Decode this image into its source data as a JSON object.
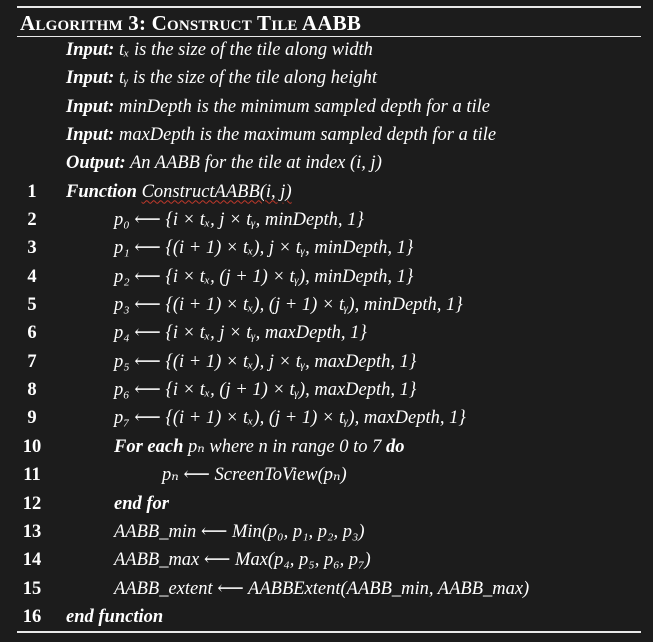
{
  "title": "Algorithm 3: Construct Tile AABB",
  "header_lines": [
    {
      "keyword": "Input:",
      "text": "tₓ is the size of the tile along width"
    },
    {
      "keyword": "Input:",
      "text": "tᵧ is the size of the tile along height"
    },
    {
      "keyword": "Input:",
      "text": "minDepth is the minimum sampled depth for a tile"
    },
    {
      "keyword": "Input:",
      "text": "maxDepth is the maximum sampled depth for a tile"
    },
    {
      "keyword": "Output:",
      "text": "An AABB for the tile at index (i, j)"
    }
  ],
  "steps": [
    {
      "num": "1",
      "keyword": "Function",
      "text": "ConstructAABB(i, j)",
      "indent": 0
    },
    {
      "num": "2",
      "keyword": "",
      "text": "p₀ ⟵ {i × tₓ, j × tᵧ, minDepth, 1}",
      "indent": 1
    },
    {
      "num": "3",
      "keyword": "",
      "text": "p₁ ⟵ {(i + 1) × tₓ), j × tᵧ, minDepth, 1}",
      "indent": 1
    },
    {
      "num": "4",
      "keyword": "",
      "text": "p₂ ⟵ {i × tₓ, (j + 1) × tᵧ), minDepth, 1}",
      "indent": 1
    },
    {
      "num": "5",
      "keyword": "",
      "text": "p₃ ⟵ {(i + 1) × tₓ), (j + 1) × tᵧ), minDepth, 1}",
      "indent": 1
    },
    {
      "num": "6",
      "keyword": "",
      "text": "p₄ ⟵ {i × tₓ, j × tᵧ, maxDepth, 1}",
      "indent": 1
    },
    {
      "num": "7",
      "keyword": "",
      "text": "p₅ ⟵ {(i + 1) × tₓ), j × tᵧ, maxDepth, 1}",
      "indent": 1
    },
    {
      "num": "8",
      "keyword": "",
      "text": "p₆ ⟵ {i × tₓ, (j + 1) × tᵧ), maxDepth, 1}",
      "indent": 1
    },
    {
      "num": "9",
      "keyword": "",
      "text": "p₇ ⟵ {(i + 1) × tₓ), (j + 1) × tᵧ), maxDepth, 1}",
      "indent": 1
    },
    {
      "num": "10",
      "keyword": "For each",
      "text": "pₙ where n in range 0 to 7",
      "keyword_after": "do",
      "indent": 1
    },
    {
      "num": "11",
      "keyword": "",
      "text": "pₙ ⟵ ScreenToView(pₙ)",
      "indent": 2
    },
    {
      "num": "12",
      "keyword": "end for",
      "text": "",
      "indent": 1
    },
    {
      "num": "13",
      "keyword": "",
      "text": "AABB_min ⟵ Min(p₀, p₁, p₂, p₃)",
      "indent": 1
    },
    {
      "num": "14",
      "keyword": "",
      "text": "AABB_max ⟵ Max(p₄, p₅, p₆, p₇)",
      "indent": 1
    },
    {
      "num": "15",
      "keyword": "",
      "text": "AABB_extent ⟵ AABBExtent(AABB_min, AABB_max)",
      "indent": 1
    },
    {
      "num": "16",
      "keyword": "end function",
      "text": "",
      "indent": 0
    }
  ],
  "colors": {
    "background": "#1c1c1c",
    "text": "#ffffff",
    "rule": "#e8e8e8",
    "spellcheck": "#c0392b"
  }
}
